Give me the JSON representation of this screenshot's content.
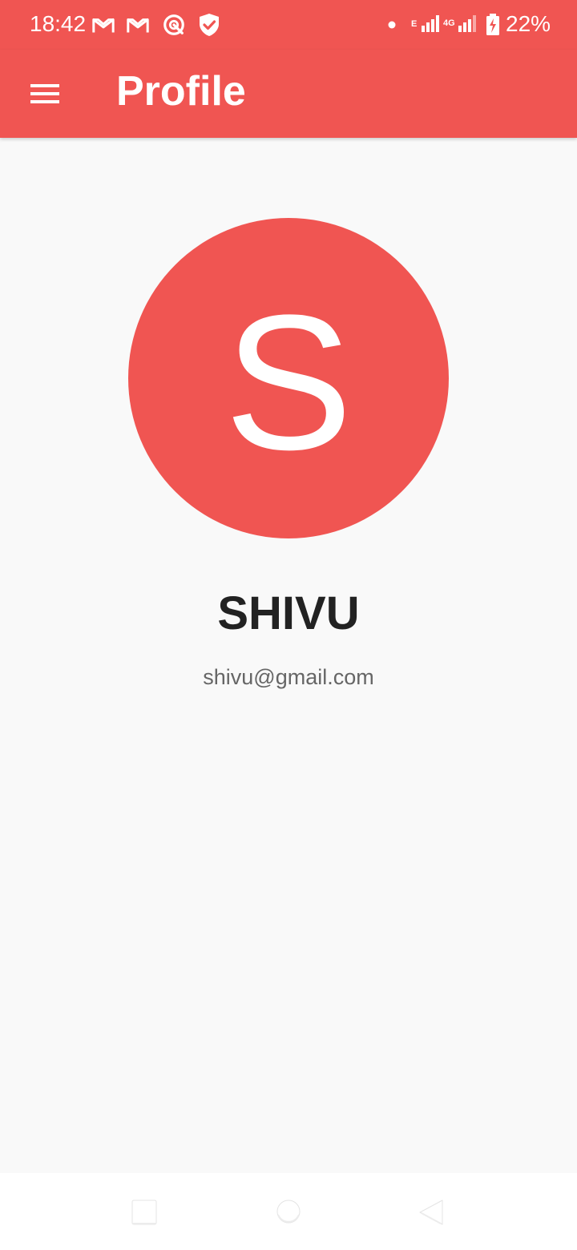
{
  "status_bar": {
    "time": "18:42",
    "battery": "22%",
    "left_icons": [
      "gmail-icon",
      "gmail-icon",
      "radar-app-icon",
      "shield-icon"
    ],
    "right_icons": [
      "notification-dot-icon",
      "edge-signal-icon",
      "4g-signal-icon",
      "battery-charging-icon"
    ],
    "network_e": "E",
    "network_4g": "4G"
  },
  "app_bar": {
    "title": "Profile",
    "menu_icon": "menu-icon"
  },
  "profile": {
    "avatar_letter": "S",
    "name": "SHIVU",
    "email": "shivu@gmail.com"
  },
  "colors": {
    "accent": "#f05552",
    "background": "#f9f9f9",
    "name_text": "#222222",
    "email_text": "#666666"
  },
  "nav_bar": {
    "icons": [
      "recent-apps-icon",
      "home-icon",
      "back-icon"
    ]
  }
}
